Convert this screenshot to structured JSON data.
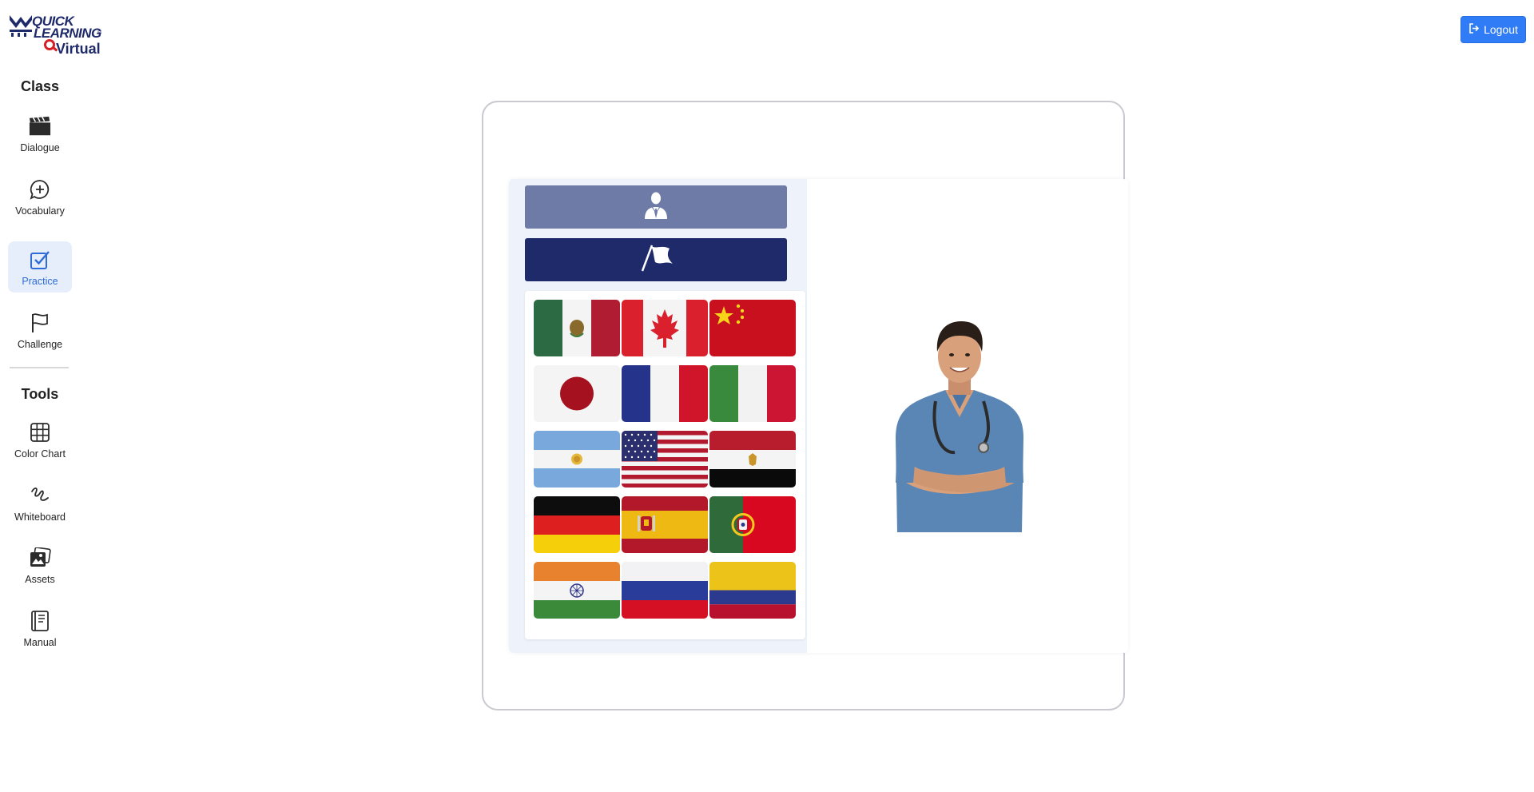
{
  "logo": {
    "line1": "QUICK",
    "line2": "LEARNING",
    "reg": "®",
    "line3": "Virtual"
  },
  "sidebar": {
    "class_title": "Class",
    "tools_title": "Tools",
    "class_items": [
      {
        "label": "Dialogue",
        "icon": "clapperboard-icon",
        "active": false
      },
      {
        "label": "Vocabulary",
        "icon": "chat-plus-icon",
        "active": false
      },
      {
        "label": "Practice",
        "icon": "checkbox-icon",
        "active": true
      },
      {
        "label": "Challenge",
        "icon": "flag-icon",
        "active": false
      }
    ],
    "tool_items": [
      {
        "label": "Color Chart",
        "icon": "grid-icon"
      },
      {
        "label": "Whiteboard",
        "icon": "scribble-icon"
      },
      {
        "label": "Assets",
        "icon": "images-icon"
      },
      {
        "label": "Manual",
        "icon": "notebook-icon"
      }
    ]
  },
  "header": {
    "logout_label": "Logout",
    "logout_icon": "logout-icon"
  },
  "practice": {
    "role_button_icon": "person-icon",
    "flag_button_icon": "waving-flag-icon",
    "flags": [
      "Mexico",
      "Canada",
      "China",
      "Japan",
      "France",
      "Italy",
      "Argentina",
      "United States",
      "Egypt",
      "Germany",
      "Spain",
      "Portugal",
      "India",
      "Russia",
      "Colombia"
    ],
    "image": "doctor-illustration"
  },
  "colors": {
    "accent": "#2f7cf6",
    "navy": "#1f2a6b",
    "slate": "#6e7ba7",
    "active_bg": "#e6edfb"
  }
}
